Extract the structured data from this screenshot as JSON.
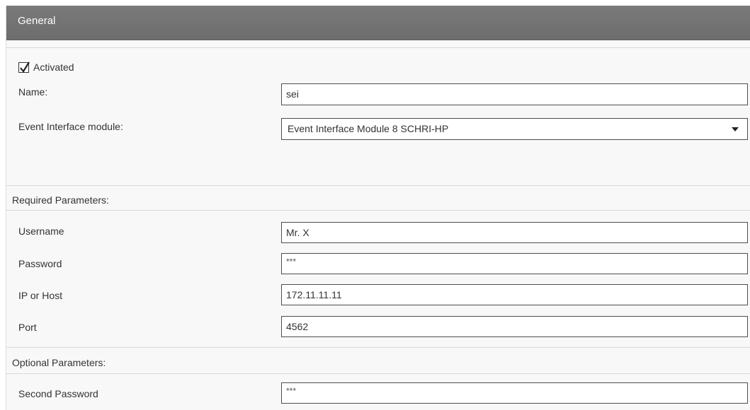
{
  "header": {
    "title": "General"
  },
  "general": {
    "activated_label": "Activated",
    "activated_checked": true,
    "name_label": "Name:",
    "name_value": "sei",
    "module_label": "Event Interface module:",
    "module_value": "Event Interface Module 8 SCHRI-HP"
  },
  "required": {
    "title": "Required Parameters:",
    "username_label": "Username",
    "username_value": "Mr. X",
    "password_label": "Password",
    "password_value": "***",
    "host_label": "IP or Host",
    "host_value": "172.11.11.11",
    "port_label": "Port",
    "port_value": "4562"
  },
  "optional": {
    "title": "Optional Parameters:",
    "second_password_label": "Second Password",
    "second_password_value": "***"
  },
  "icons": {
    "checkbox": "checkmark-icon",
    "dropdown": "caret-down-icon"
  },
  "colors": {
    "header_bg": "#737373",
    "panel_bg": "#f8f8f8",
    "field_border": "#4d4d4d"
  }
}
